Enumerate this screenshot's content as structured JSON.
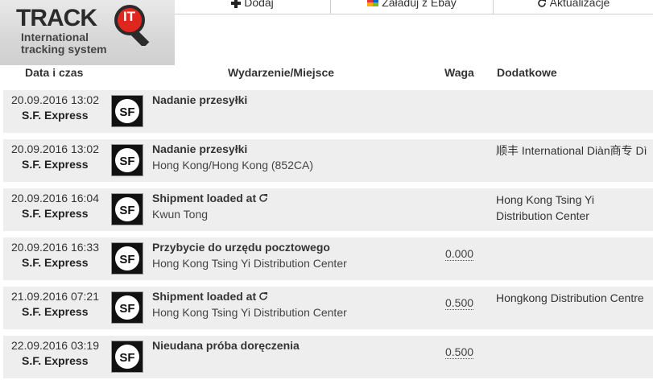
{
  "logo": {
    "track": "TRACK",
    "it": "IT",
    "line1": "International",
    "line2": "tracking system"
  },
  "toolbar": {
    "add_label": "Dodaj",
    "ebay_label": "Załaduj z Ebay",
    "refresh_label": "Aktualizacje"
  },
  "table": {
    "headers": {
      "datetime": "Data i czas",
      "event": "Wydarzenie/Miejsce",
      "weight": "Waga",
      "extra": "Dodatkowe"
    },
    "rows": [
      {
        "date": "20.09.2016 13:02",
        "carrier": "S.F. Express",
        "title": "Nadanie przesyłki",
        "place": "",
        "weight": "",
        "extra": ""
      },
      {
        "date": "20.09.2016 13:02",
        "carrier": "S.F. Express",
        "title": "Nadanie przesyłki",
        "place": "Hong Kong/Hong Kong (852CA)",
        "weight": "",
        "extra": "顺丰 International Diàn商专 Dì"
      },
      {
        "date": "20.09.2016 16:04",
        "carrier": "S.F. Express",
        "title": "Shipment loaded at",
        "place": "Kwun Tong",
        "weight": "",
        "extra": "Hong Kong Tsing Yi Distribution Center"
      },
      {
        "date": "20.09.2016 16:33",
        "carrier": "S.F. Express",
        "title": "Przybycie do urzędu pocztowego",
        "place": "Hong Kong Tsing Yi Distribution Center",
        "weight": "0.000",
        "extra": ""
      },
      {
        "date": "21.09.2016 07:21",
        "carrier": "S.F. Express",
        "title": "Shipment loaded at",
        "place": "Hong Kong Tsing Yi Distribution Center",
        "weight": "0.500",
        "extra": "Hongkong Distribution Centre"
      },
      {
        "date": "22.09.2016 03:19",
        "carrier": "S.F. Express",
        "title": "Nieudana próba doręczenia",
        "place": "",
        "weight": "0.500",
        "extra": ""
      }
    ]
  },
  "colors": {
    "row_bg": "#eeeeee",
    "text": "#333333"
  }
}
